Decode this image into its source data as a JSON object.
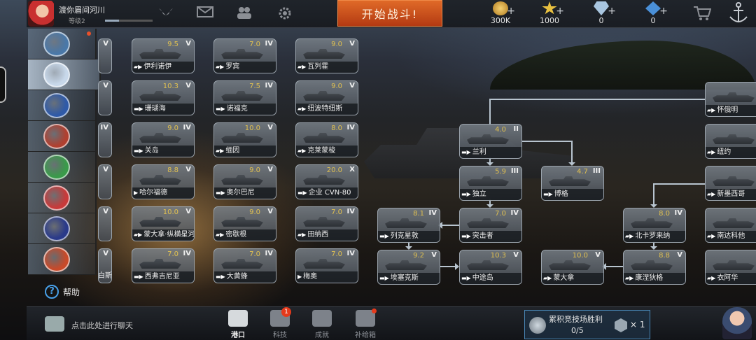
{
  "player": {
    "name": "渡你眉间河川",
    "level": "等级2",
    "xp_progress": 0.3
  },
  "top_icons": [
    "wings-icon",
    "mail-icon",
    "friends-icon",
    "settings-icon"
  ],
  "start_battle": "开始战斗!",
  "currencies": [
    {
      "name": "gold-coin-icon",
      "value": "300K",
      "color": "#d8a840"
    },
    {
      "name": "star-icon",
      "value": "1000",
      "color": "#e8c040"
    },
    {
      "name": "diamond-icon",
      "value": "0",
      "color": "#a9c6e0"
    },
    {
      "name": "blue-gem-icon",
      "value": "0",
      "color": "#4a90d8"
    }
  ],
  "shop_icon": "cart-icon",
  "anchor_icon": "anchor-icon",
  "nations": [
    {
      "name": "nation-flag-1",
      "color": "#4a78a8",
      "active": false,
      "dot": true
    },
    {
      "name": "nation-flag-usa",
      "color": "#c8d8ea",
      "active": true,
      "dot": false
    },
    {
      "name": "nation-flag-france",
      "color": "#2f5aa8",
      "active": false,
      "dot": false
    },
    {
      "name": "nation-flag-germany",
      "color": "#b04030",
      "active": false,
      "dot": false
    },
    {
      "name": "nation-flag-italy",
      "color": "#3a9a4a",
      "active": false,
      "dot": false
    },
    {
      "name": "nation-flag-japan",
      "color": "#c83a3a",
      "active": false,
      "dot": false
    },
    {
      "name": "nation-flag-uk",
      "color": "#2a3a8a",
      "active": false,
      "dot": false
    },
    {
      "name": "nation-flag-soviet",
      "color": "#c84a2a",
      "active": false,
      "dot": false
    }
  ],
  "help": "帮助",
  "columns": {
    "col0": [
      {
        "tier": "V"
      },
      {
        "tier": "V"
      },
      {
        "tier": "IV"
      },
      {
        "tier": "V"
      },
      {
        "tier": "V"
      },
      {
        "tier": "V",
        "name": "白斯"
      }
    ],
    "col1": [
      {
        "rating": "9.5",
        "tier": "V",
        "type": "▰▶",
        "name": "伊利诺伊"
      },
      {
        "rating": "10.3",
        "tier": "V",
        "type": "▬▶",
        "name": "珊瑚海"
      },
      {
        "rating": "9.0",
        "tier": "IV",
        "type": "▬▶",
        "name": "关岛"
      },
      {
        "rating": "8.8",
        "tier": "V",
        "type": "▶",
        "name": "哈尔福德"
      },
      {
        "rating": "10.0",
        "tier": "V",
        "type": "▰▶",
        "name": "蒙大拿·纵横星河"
      },
      {
        "rating": "7.0",
        "tier": "IV",
        "type": "▬▶",
        "name": "西弗吉尼亚"
      }
    ],
    "col2": [
      {
        "rating": "7.0",
        "tier": "IV",
        "type": "▰▶",
        "name": "罗宾"
      },
      {
        "rating": "7.5",
        "tier": "IV",
        "type": "▬▶",
        "name": "诺福克"
      },
      {
        "rating": "10.0",
        "tier": "V",
        "type": "▰▶",
        "name": "缅因"
      },
      {
        "rating": "9.0",
        "tier": "V",
        "type": "▬▶",
        "name": "奥尔巴尼"
      },
      {
        "rating": "9.0",
        "tier": "V",
        "type": "▰▶",
        "name": "密歇根"
      },
      {
        "rating": "7.0",
        "tier": "IV",
        "type": "▬▶",
        "name": "大黄蜂"
      }
    ],
    "col3": [
      {
        "rating": "9.0",
        "tier": "V",
        "type": "▰▶",
        "name": "瓦列霍"
      },
      {
        "rating": "9.0",
        "tier": "V",
        "type": "▰▶",
        "name": "纽波特纽斯"
      },
      {
        "rating": "8.0",
        "tier": "IV",
        "type": "▰▶",
        "name": "克莱蒙梭"
      },
      {
        "rating": "20.0",
        "tier": "X",
        "type": "▬▶",
        "name": "企业 CVN-80"
      },
      {
        "rating": "7.0",
        "tier": "IV",
        "type": "▰▶",
        "name": "田纳西"
      },
      {
        "rating": "7.0",
        "tier": "IV",
        "type": "▶",
        "name": "梅奥"
      }
    ]
  },
  "tree": [
    {
      "key": "lanli",
      "rating": "4.0",
      "tier": "II",
      "type": "▬▶",
      "name": "兰利"
    },
    {
      "key": "duli",
      "rating": "5.9",
      "tier": "III",
      "type": "▬▶",
      "name": "独立"
    },
    {
      "key": "boge",
      "rating": "4.7",
      "tier": "III",
      "type": "▬▶",
      "name": "博格"
    },
    {
      "key": "liekexingdun",
      "rating": "8.1",
      "tier": "IV",
      "type": "▬▶",
      "name": "列克星敦"
    },
    {
      "key": "tujizhe",
      "rating": "7.0",
      "tier": "IV",
      "type": "▬▶",
      "name": "突击者"
    },
    {
      "key": "aisaikesi",
      "rating": "9.2",
      "tier": "V",
      "type": "▬▶",
      "name": "埃塞克斯"
    },
    {
      "key": "zhongtudao",
      "rating": "10.3",
      "tier": "V",
      "type": "▬▶",
      "name": "中途岛"
    },
    {
      "key": "mengdana",
      "rating": "10.0",
      "tier": "V",
      "type": "▰▶",
      "name": "蒙大拿"
    },
    {
      "key": "beikaluolaina",
      "rating": "8.0",
      "tier": "IV",
      "type": "▰▶",
      "name": "北卡罗来纳"
    },
    {
      "key": "kangniedige",
      "rating": "8.8",
      "tier": "V",
      "type": "▰▶",
      "name": "康涅狄格"
    },
    {
      "key": "huaieming",
      "rating": "",
      "tier": "",
      "type": "▰▶",
      "name": "怀俄明"
    },
    {
      "key": "niuyue",
      "rating": "",
      "tier": "",
      "type": "▰▶",
      "name": "纽约"
    },
    {
      "key": "xinmoxige",
      "rating": "",
      "tier": "",
      "type": "▰▶",
      "name": "新墨西哥"
    },
    {
      "key": "nandakeda",
      "rating": "",
      "tier": "",
      "type": "▰▶",
      "name": "南达科他"
    },
    {
      "key": "yiahua",
      "rating": "",
      "tier": "",
      "type": "▰▶",
      "name": "衣阿华"
    }
  ],
  "bottom": {
    "chat": "点击此处进行聊天",
    "nav": [
      {
        "key": "port",
        "label": "港口",
        "active": true,
        "badge": "",
        "dot": false
      },
      {
        "key": "tech",
        "label": "科技",
        "active": false,
        "badge": "1",
        "dot": false
      },
      {
        "key": "achieve",
        "label": "成就",
        "active": false,
        "badge": "",
        "dot": false
      },
      {
        "key": "supply",
        "label": "补给箱",
        "active": false,
        "badge": "",
        "dot": true
      }
    ],
    "arena": {
      "title": "累积竞技场胜利",
      "progress": "0/5",
      "reward": "× 1"
    }
  }
}
